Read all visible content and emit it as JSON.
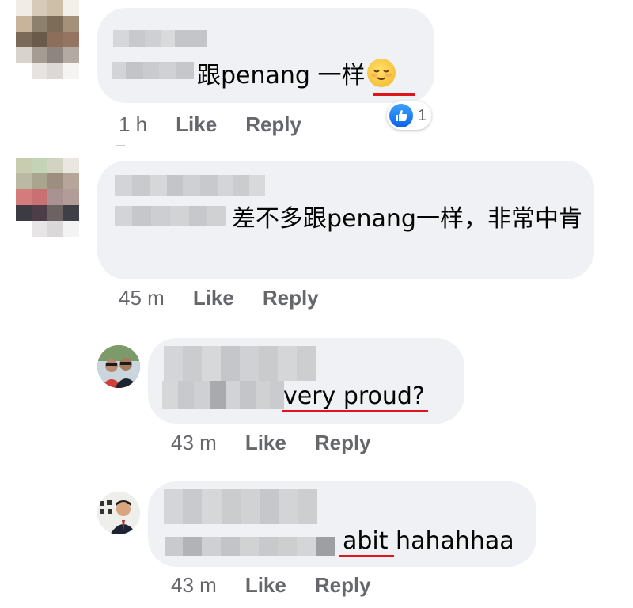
{
  "comments": [
    {
      "time": "1 h",
      "like": "Like",
      "reply": "Reply",
      "text": "跟penang 一样",
      "emoji": "relieved-face-emoji",
      "reaction_count": "1"
    },
    {
      "time": "45 m",
      "like": "Like",
      "reply": "Reply",
      "text": "差不多跟penang一样，非常中肯"
    },
    {
      "time": "43 m",
      "like": "Like",
      "reply": "Reply",
      "text": "very proud?"
    },
    {
      "time": "43 m",
      "like": "Like",
      "reply": "Reply",
      "text": "abit hahahhaa"
    }
  ],
  "colors": {
    "bubble": "#eff1f4",
    "meta_text": "#65676b",
    "highlight_underline": "#e0141b",
    "like_blue": "#1877f2"
  }
}
